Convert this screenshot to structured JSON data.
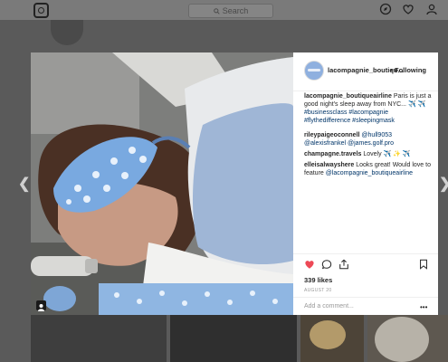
{
  "header": {
    "search_placeholder": "Search"
  },
  "post": {
    "username": "lacompagnie_boutiqu...",
    "separator": "•",
    "follow_state": "Following",
    "caption": {
      "user": "lacompagnie_boutiqueairline",
      "text": "Paris is just a good night's sleep away from NYC... ✈️ ✈️",
      "hashtags": "#businessclass #lacompagnie #flythedifference #sleepingmask"
    },
    "comments": [
      {
        "user": "rileypaigeoconnell",
        "text": "@hull9053",
        "text2": "@alexisfrankel @james.golf.pro"
      },
      {
        "user": "champagne.travels",
        "text": "Lovely ✈️ ✨ ✈️"
      },
      {
        "user": "elleisalwayshere",
        "text": "Looks great! Would love to feature",
        "mention": "@lacompagnie_boutiqueairline"
      }
    ],
    "likes": "339 likes",
    "date": "AUGUST 20",
    "comment_placeholder": "Add a comment...",
    "more": "•••"
  },
  "colors": {
    "accent_heart": "#ed4956",
    "link": "#003569",
    "overlay": "#5a5a5a"
  },
  "icons": [
    "instagram-icon",
    "search-icon",
    "compass-icon",
    "heart-icon",
    "person-icon",
    "chevron-left-icon",
    "chevron-right-icon",
    "comment-icon",
    "share-icon",
    "bookmark-icon",
    "user-tag-icon"
  ]
}
